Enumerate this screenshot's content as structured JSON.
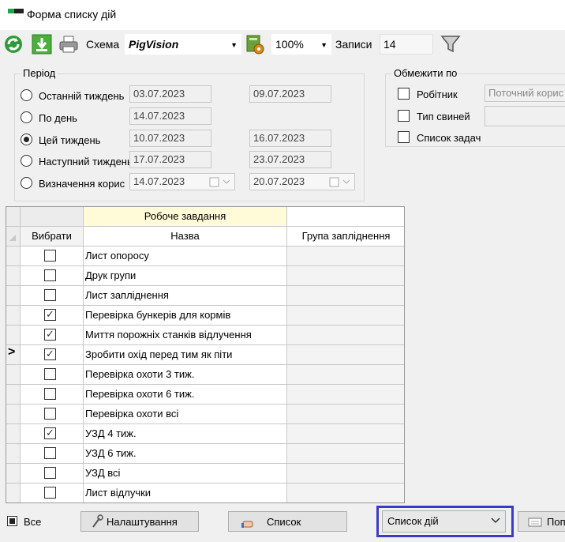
{
  "window": {
    "title": "Форма списку дій"
  },
  "toolbar": {
    "schema_label": "Схема",
    "schema_value": "PigVision",
    "zoom_value": "100%",
    "records_label": "Записи",
    "records_value": "14",
    "icons": [
      "refresh-icon",
      "download-icon",
      "print-icon",
      "settings-icon",
      "filter-icon"
    ]
  },
  "period": {
    "title": "Період",
    "options": [
      {
        "label": "Останній тиждень",
        "from": "03.07.2023",
        "to": "09.07.2023",
        "selected": false
      },
      {
        "label": "По день",
        "from": "14.07.2023",
        "to": "",
        "selected": false
      },
      {
        "label": "Цей тиждень",
        "from": "10.07.2023",
        "to": "16.07.2023",
        "selected": true
      },
      {
        "label": "Наступний тиждень",
        "from": "17.07.2023",
        "to": "23.07.2023",
        "selected": false
      },
      {
        "label": "Визначення корис",
        "from": "14.07.2023",
        "to": "20.07.2023",
        "selected": false
      }
    ]
  },
  "limit": {
    "title": "Обмежити по",
    "worker_label": "Робітник",
    "worker_value": "Поточний корис",
    "pig_type_label": "Тип свиней",
    "task_list_label": "Список задач"
  },
  "grid": {
    "band_header": "Робоче завдання",
    "col_select": "Вибрати",
    "col_name": "Назва",
    "col_group": "Група запліднення",
    "current_row": 5,
    "rows": [
      {
        "name": "Лист опоросу",
        "checked": false
      },
      {
        "name": "Друк групи",
        "checked": false
      },
      {
        "name": "Лист запліднення",
        "checked": false
      },
      {
        "name": "Перевірка бункерів для кормів",
        "checked": true
      },
      {
        "name": "Миття порожніх станків відлучення",
        "checked": true
      },
      {
        "name": "Зробити охід перед тим як піти",
        "checked": true
      },
      {
        "name": "Перевірка охоти 3 тиж.",
        "checked": false
      },
      {
        "name": "Перевірка охоти 6 тиж.",
        "checked": false
      },
      {
        "name": "Перевірка охоти всі",
        "checked": false
      },
      {
        "name": "УЗД 4 тиж.",
        "checked": true
      },
      {
        "name": "УЗД 6 тиж.",
        "checked": false
      },
      {
        "name": "УЗД всі",
        "checked": false
      },
      {
        "name": "Лист відлучки",
        "checked": false
      }
    ]
  },
  "bottom": {
    "all_label": "Все",
    "settings_button": "Налаштування",
    "list_button": "Список",
    "list_select_value": "Список дій",
    "print_button": "Поп"
  }
}
